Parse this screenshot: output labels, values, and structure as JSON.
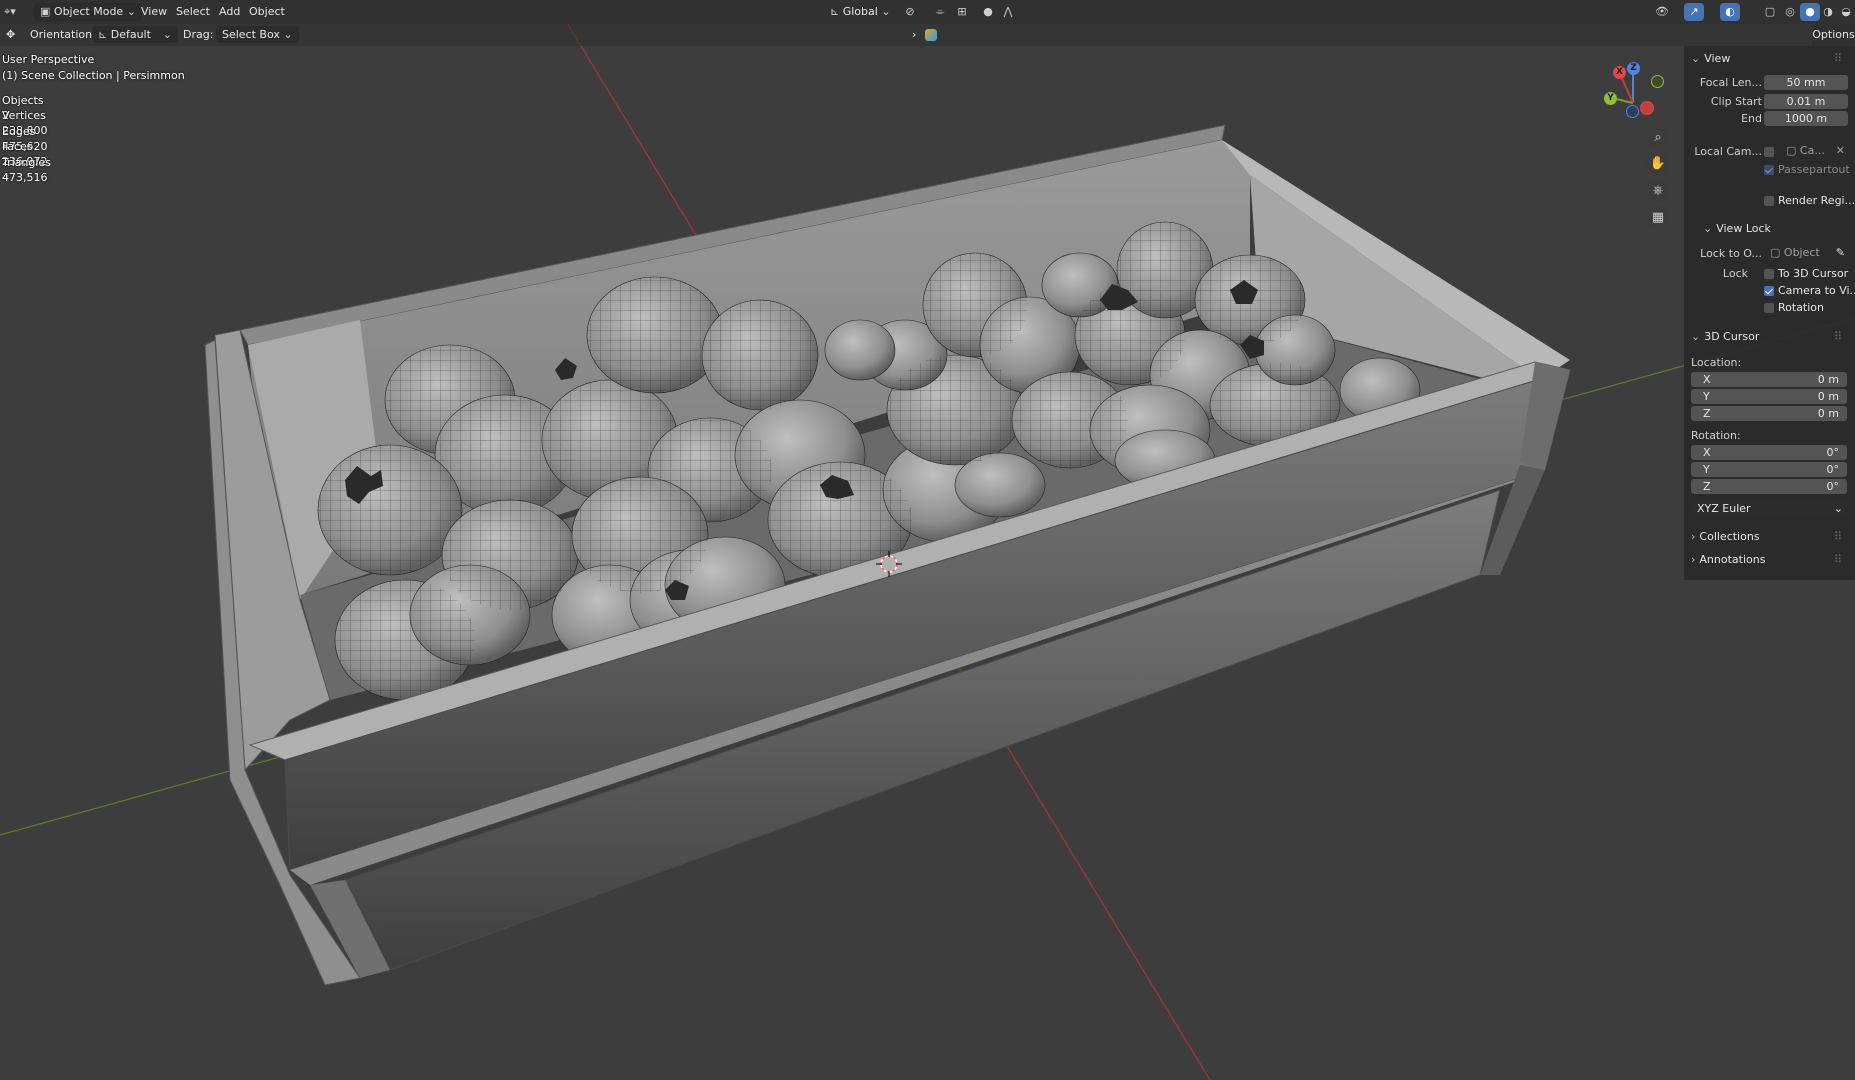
{
  "header": {
    "editor_icon": "editor-type-3d-viewport-icon",
    "mode": "Object Mode",
    "menus": [
      "View",
      "Select",
      "Add",
      "Object"
    ],
    "transform_orientation": "Global",
    "orientation_label": "Orientation:",
    "orientation_value": "Default",
    "drag_label": "Drag:",
    "drag_value": "Select Box",
    "options_tab": "Options"
  },
  "overlay": {
    "perspective": "User Perspective",
    "collection": "(1) Scene Collection | Persimmon",
    "stats": [
      {
        "label": "Objects",
        "value": "2"
      },
      {
        "label": "Vertices",
        "value": "238,800"
      },
      {
        "label": "Edges",
        "value": "475,620"
      },
      {
        "label": "Faces",
        "value": "236,972"
      },
      {
        "label": "Triangles",
        "value": "473,516"
      }
    ]
  },
  "gizmo": {
    "x": "X",
    "y": "Y",
    "z": "Z"
  },
  "panel": {
    "view_title": "View",
    "focal_label": "Focal Len...",
    "focal_value": "50 mm",
    "clip_start_label": "Clip Start",
    "clip_start_value": "0.01 m",
    "end_label": "End",
    "end_value": "1000 m",
    "local_cam_label": "Local Cam...",
    "local_cam_value": "Ca...",
    "passepartout": "Passepartout",
    "render_region": "Render Regi...",
    "view_lock_title": "View Lock",
    "lock_to_label": "Lock to O...",
    "lock_to_value": "Object",
    "lock_label": "Lock",
    "to_3d_cursor": "To 3D Cursor",
    "camera_to_view": "Camera to Vi...",
    "rotation_check": "Rotation",
    "cursor_title": "3D Cursor",
    "location_label": "Location:",
    "loc_x_label": "X",
    "loc_x": "0 m",
    "loc_y_label": "Y",
    "loc_y": "0 m",
    "loc_z_label": "Z",
    "loc_z": "0 m",
    "rotation_label": "Rotation:",
    "rot_x_label": "X",
    "rot_x": "0°",
    "rot_y_label": "Y",
    "rot_y": "0°",
    "rot_z_label": "Z",
    "rot_z": "0°",
    "rotation_mode": "XYZ Euler",
    "collections": "Collections",
    "annotations": "Annotations"
  },
  "colors": {
    "viewport_bg": "#3d3d3d",
    "accent": "#4772b3",
    "axis_x": "#b03a3a",
    "axis_y": "#6a8a2a"
  }
}
